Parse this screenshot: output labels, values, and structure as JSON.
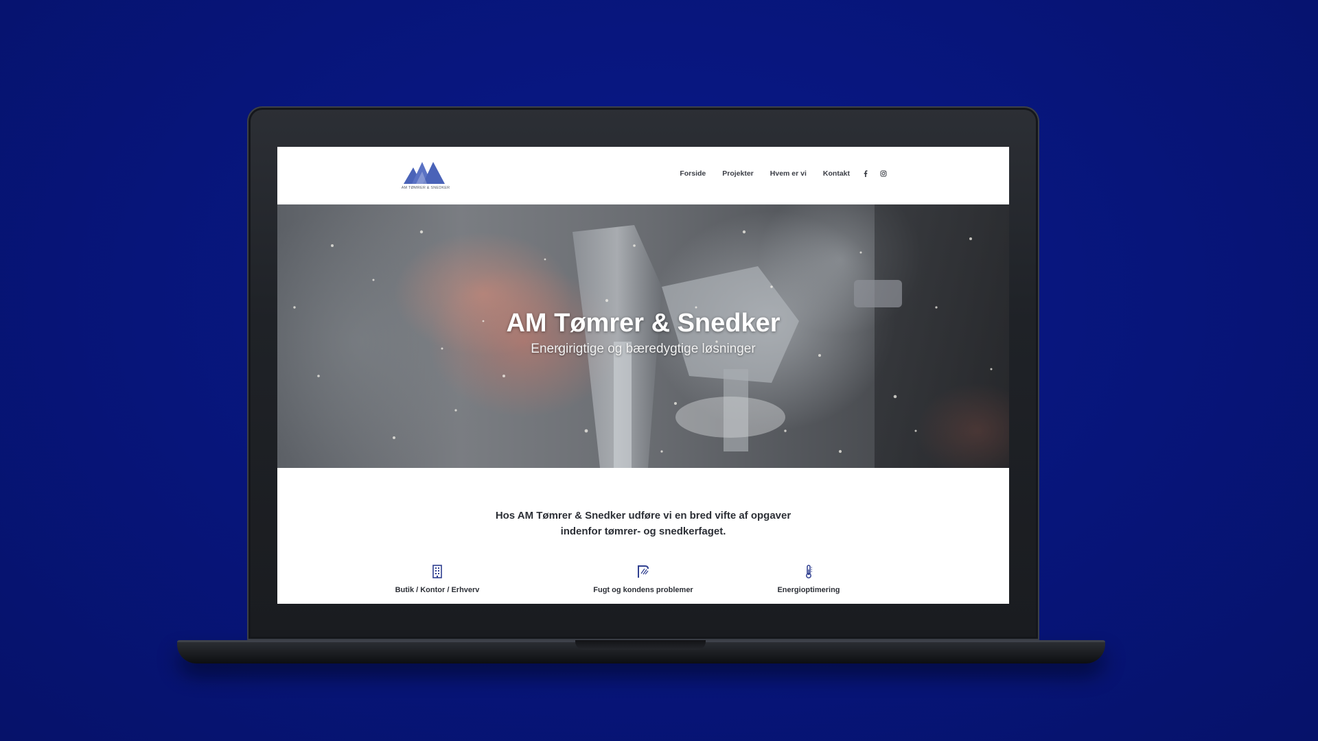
{
  "colors": {
    "background": "#07157a",
    "brand": "#4a63b8",
    "icon": "#2f3f8f"
  },
  "header": {
    "logo_text": "AM TØMRER & SNEDKER",
    "nav": [
      {
        "label": "Forside"
      },
      {
        "label": "Projekter"
      },
      {
        "label": "Hvem er vi"
      },
      {
        "label": "Kontakt"
      }
    ],
    "social": [
      "facebook-icon",
      "instagram-icon"
    ]
  },
  "hero": {
    "title": "AM Tømrer & Snedker",
    "subtitle": "Energirigtige og bæredygtige løsninger"
  },
  "intro": {
    "line1": "Hos AM Tømrer & Snedker udføre vi en bred vifte af opgaver",
    "line2": "indenfor tømrer- og snedkerfaget."
  },
  "services": [
    {
      "label": "Butik / Kontor / Erhverv",
      "icon": "building-icon"
    },
    {
      "label": "Fugt og kondens problemer",
      "icon": "moisture-icon"
    },
    {
      "label": "Energioptimering",
      "icon": "thermometer-icon"
    }
  ]
}
